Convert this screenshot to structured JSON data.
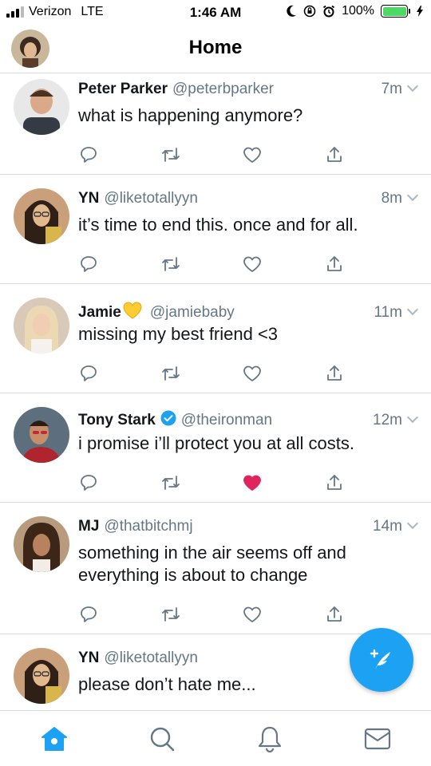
{
  "status_bar": {
    "carrier": "Verizon",
    "network": "LTE",
    "time": "1:46 AM",
    "battery": "100%",
    "battery_color": "#4cd964"
  },
  "header": {
    "title": "Home",
    "profile_avatar_icon": "user-avatar"
  },
  "colors": {
    "accent": "#1da1f2",
    "secondary_text": "#657786",
    "like_active": "#e0245e"
  },
  "tweets": [
    {
      "name": "Peter Parker",
      "handle": "@peterbparker",
      "time": "7m",
      "text": "what is happening anymore?",
      "liked": false,
      "verified": false
    },
    {
      "name": "YN",
      "handle": "@liketotallyyn",
      "time": "8m",
      "text": "it’s time to end this. once and for all.",
      "liked": false,
      "verified": false
    },
    {
      "name": "Jamie",
      "name_emoji": "yellow-heart",
      "handle": "@jamiebaby",
      "time": "11m",
      "text": "missing my best friend <3",
      "liked": false,
      "verified": false
    },
    {
      "name": "Tony Stark",
      "handle": "@theironman",
      "time": "12m",
      "text": "i promise i’ll protect you at all costs.",
      "liked": true,
      "verified": true
    },
    {
      "name": "MJ",
      "handle": "@thatbitchmj",
      "time": "14m",
      "text": "something in the air seems off and\neverything is about to change",
      "liked": false,
      "verified": false
    },
    {
      "name": "YN",
      "handle": "@liketotallyyn",
      "time": "",
      "text": "please don’t hate me...",
      "liked": false,
      "verified": false
    }
  ],
  "tab_bar": {
    "items": [
      "home-icon",
      "search-icon",
      "notifications-icon",
      "messages-icon"
    ],
    "active": "home-icon"
  },
  "fab": {
    "icon": "compose-tweet-icon"
  }
}
